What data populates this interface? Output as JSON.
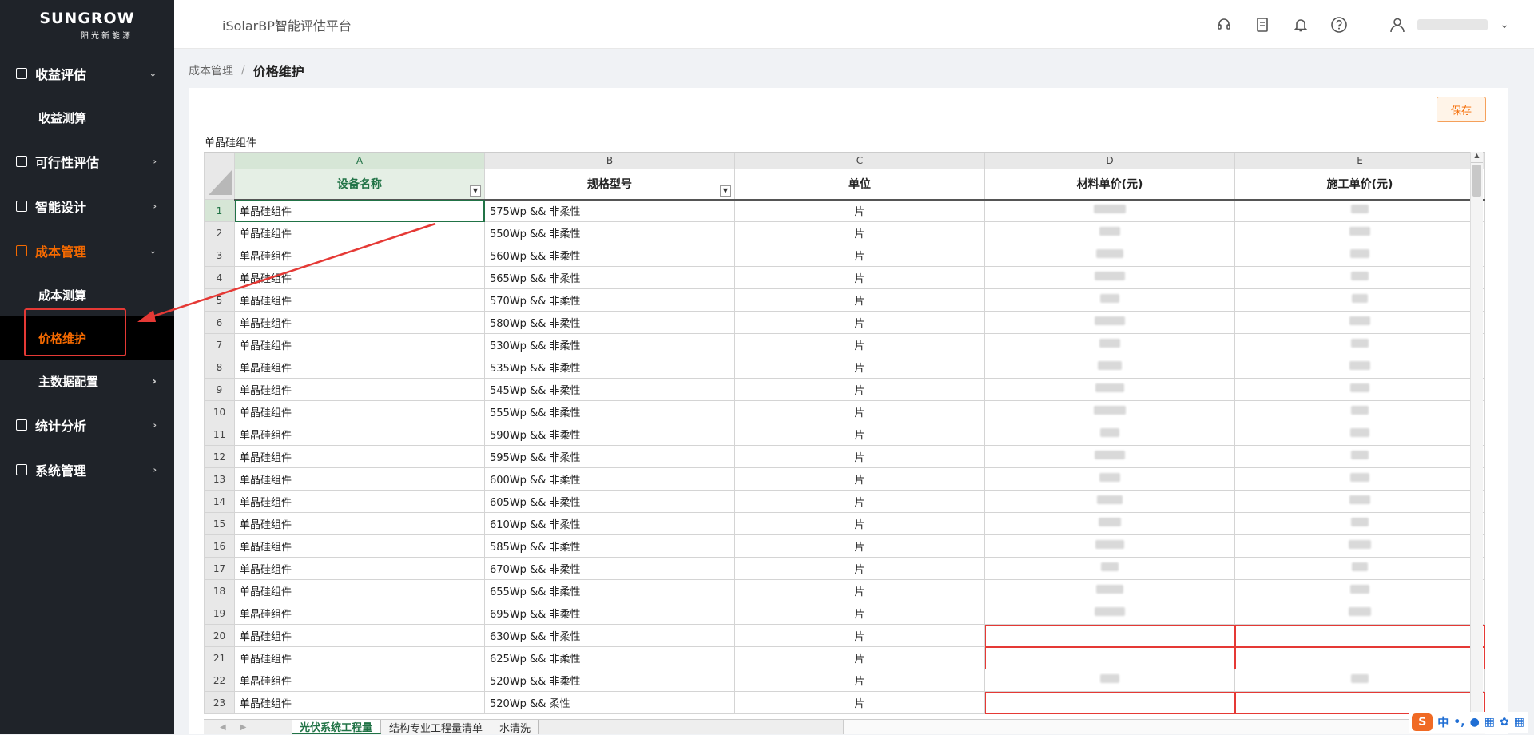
{
  "brand": {
    "name": "SUNGROW",
    "sub": "阳光新能源"
  },
  "app_title": "iSolarBP智能评估平台",
  "sidebar": {
    "items": [
      {
        "label": "收益评估",
        "expanded": true,
        "children": [
          {
            "label": "收益测算"
          }
        ]
      },
      {
        "label": "可行性评估"
      },
      {
        "label": "智能设计"
      },
      {
        "label": "成本管理",
        "expanded": true,
        "active": true,
        "children": [
          {
            "label": "成本测算"
          },
          {
            "label": "价格维护",
            "active": true
          },
          {
            "label": "主数据配置"
          }
        ]
      },
      {
        "label": "统计分析"
      },
      {
        "label": "系统管理"
      }
    ]
  },
  "header_icons": [
    "headset-icon",
    "document-icon",
    "bell-icon",
    "help-icon",
    "user-icon",
    "chevron-down-icon"
  ],
  "breadcrumb": {
    "parent": "成本管理",
    "separator": "/",
    "current": "价格维护"
  },
  "toolbar": {
    "save_label": "保存"
  },
  "sheet": {
    "title": "单晶硅组件",
    "columns": [
      "A",
      "B",
      "C",
      "D",
      "E"
    ],
    "headers": [
      "设备名称",
      "规格型号",
      "单位",
      "材料单价(元)",
      "施工单价(元)"
    ],
    "rows": [
      {
        "n": "1",
        "name": "单晶硅组件",
        "spec": "575Wp && 非柔性",
        "unit": "片"
      },
      {
        "n": "2",
        "name": "单晶硅组件",
        "spec": "550Wp && 非柔性",
        "unit": "片"
      },
      {
        "n": "3",
        "name": "单晶硅组件",
        "spec": "560Wp && 非柔性",
        "unit": "片"
      },
      {
        "n": "4",
        "name": "单晶硅组件",
        "spec": "565Wp && 非柔性",
        "unit": "片"
      },
      {
        "n": "5",
        "name": "单晶硅组件",
        "spec": "570Wp && 非柔性",
        "unit": "片"
      },
      {
        "n": "6",
        "name": "单晶硅组件",
        "spec": "580Wp && 非柔性",
        "unit": "片"
      },
      {
        "n": "7",
        "name": "单晶硅组件",
        "spec": "530Wp && 非柔性",
        "unit": "片"
      },
      {
        "n": "8",
        "name": "单晶硅组件",
        "spec": "535Wp && 非柔性",
        "unit": "片"
      },
      {
        "n": "9",
        "name": "单晶硅组件",
        "spec": "545Wp && 非柔性",
        "unit": "片"
      },
      {
        "n": "10",
        "name": "单晶硅组件",
        "spec": "555Wp && 非柔性",
        "unit": "片"
      },
      {
        "n": "11",
        "name": "单晶硅组件",
        "spec": "590Wp && 非柔性",
        "unit": "片"
      },
      {
        "n": "12",
        "name": "单晶硅组件",
        "spec": "595Wp && 非柔性",
        "unit": "片"
      },
      {
        "n": "13",
        "name": "单晶硅组件",
        "spec": "600Wp && 非柔性",
        "unit": "片"
      },
      {
        "n": "14",
        "name": "单晶硅组件",
        "spec": "605Wp && 非柔性",
        "unit": "片"
      },
      {
        "n": "15",
        "name": "单晶硅组件",
        "spec": "610Wp && 非柔性",
        "unit": "片"
      },
      {
        "n": "16",
        "name": "单晶硅组件",
        "spec": "585Wp && 非柔性",
        "unit": "片"
      },
      {
        "n": "17",
        "name": "单晶硅组件",
        "spec": "670Wp && 非柔性",
        "unit": "片"
      },
      {
        "n": "18",
        "name": "单晶硅组件",
        "spec": "655Wp && 非柔性",
        "unit": "片"
      },
      {
        "n": "19",
        "name": "单晶硅组件",
        "spec": "695Wp && 非柔性",
        "unit": "片"
      },
      {
        "n": "20",
        "name": "单晶硅组件",
        "spec": "630Wp && 非柔性",
        "unit": "片",
        "empty": true
      },
      {
        "n": "21",
        "name": "单晶硅组件",
        "spec": "625Wp && 非柔性",
        "unit": "片",
        "empty": true
      },
      {
        "n": "22",
        "name": "单晶硅组件",
        "spec": "520Wp && 非柔性",
        "unit": "片"
      },
      {
        "n": "23",
        "name": "单晶硅组件",
        "spec": "520Wp && 柔性",
        "unit": "片",
        "empty": true
      }
    ]
  },
  "tabs": [
    "光伏系统工程量",
    "结构专业工程量清单",
    "水清洗"
  ],
  "ime": {
    "logo": "S",
    "lang": "中"
  },
  "colors": {
    "accent": "#f56a00",
    "sidebar_bg": "#1f2329",
    "excel_green": "#217346",
    "annotation_red": "#e53935"
  }
}
